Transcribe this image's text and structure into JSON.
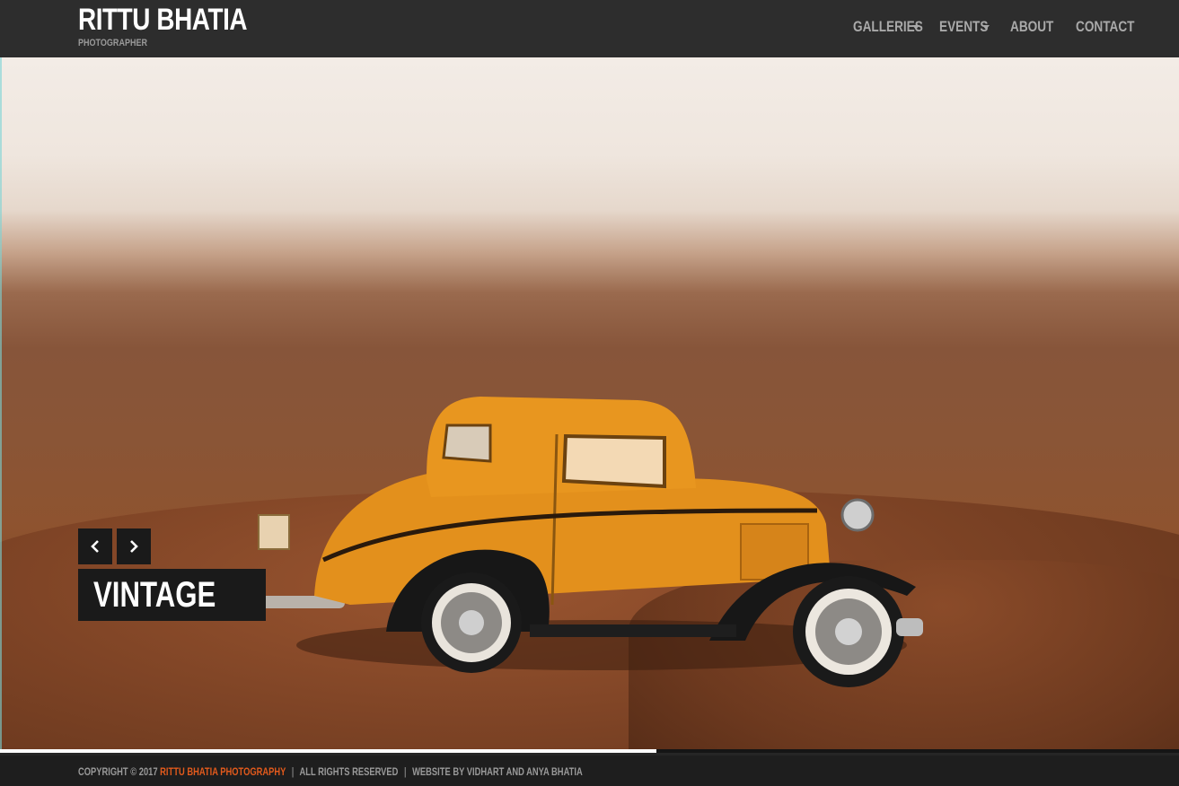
{
  "brand": {
    "name": "RITTU BHATIA",
    "subtitle": "PHOTOGRAPHER"
  },
  "nav": {
    "items": [
      {
        "label": "GALLERIES",
        "has_dropdown": true,
        "icon": "chevron-down-icon"
      },
      {
        "label": "EVENTS",
        "has_dropdown": true,
        "icon": "chevron-down-icon"
      },
      {
        "label": "ABOUT",
        "has_dropdown": false
      },
      {
        "label": "CONTACT",
        "has_dropdown": false
      }
    ]
  },
  "slider": {
    "prev_icon": "chevron-left-icon",
    "next_icon": "chevron-right-icon",
    "caption": "VINTAGE",
    "progress": 0.557
  },
  "footer": {
    "copyright": "COPYRIGHT © 2017",
    "studio_link": "RITTU BHATIA PHOTOGRAPHY",
    "separator": "|",
    "rights": "ALL RIGHTS RESERVED",
    "credits": "WEBSITE BY VIDHART AND ANYA BHATIA"
  },
  "colors": {
    "header_bg": "#2d2d2d",
    "footer_bg": "#1e1e1e",
    "accent": "#e25a1c",
    "nav_text": "#a9a9a9",
    "car_body": "#e8951d"
  }
}
